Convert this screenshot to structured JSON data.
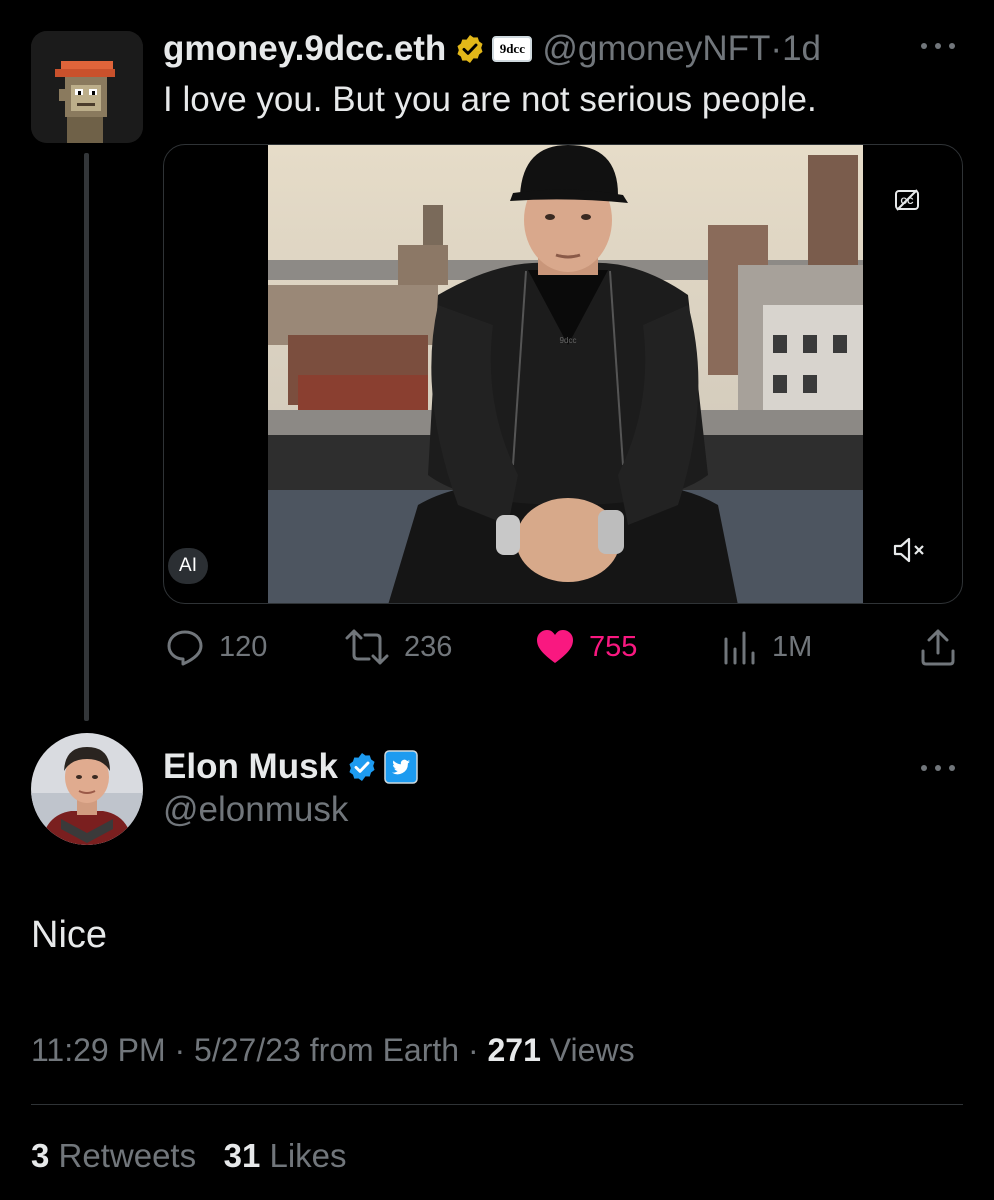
{
  "quoted_tweet": {
    "display_name": "gmoney.9dcc.eth",
    "affiliation_badge": "9dcc",
    "handle": "@gmoneyNFT",
    "separator": " · ",
    "age": "1d",
    "text": "I love you.  But you are not serious people.",
    "media": {
      "ai_label": "AI",
      "shirt_logo": "9dcc",
      "icons": [
        "closed-captions-icon",
        "mute-icon"
      ]
    },
    "actions": {
      "replies": "120",
      "retweets": "236",
      "likes": "755",
      "views": "1M"
    },
    "colors": {
      "like": "#f91880",
      "gold_verified": "#e2b719"
    }
  },
  "main_tweet": {
    "display_name": "Elon Musk",
    "handle": "@elonmusk",
    "text": "Nice",
    "time": "11:29 PM",
    "date": "5/27/23",
    "source": "from Earth",
    "dot": " · ",
    "views_count": "271",
    "views_label": "Views",
    "retweets_count": "3",
    "retweets_label": "Retweets",
    "likes_count": "31",
    "likes_label": "Likes",
    "colors": {
      "blue_verified": "#1d9bf0"
    }
  }
}
